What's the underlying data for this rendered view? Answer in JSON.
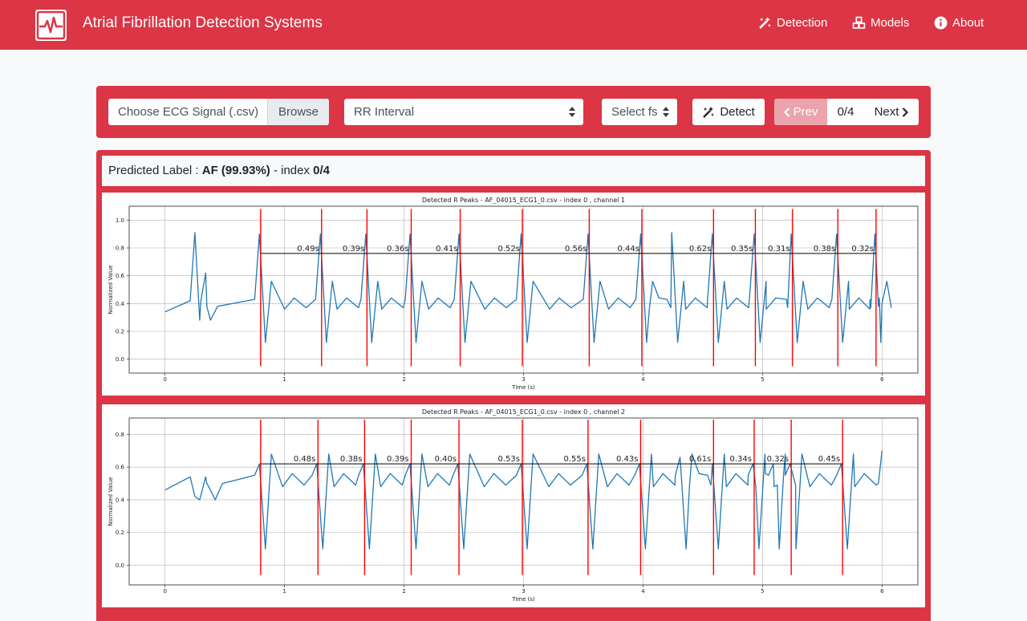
{
  "navbar": {
    "title": "Atrial Fibrillation Detection Systems",
    "logo_icon": "heartbeat-logo-icon",
    "items": [
      {
        "label": "Detection",
        "icon": "magic-wand-icon"
      },
      {
        "label": "Models",
        "icon": "cubes-icon"
      },
      {
        "label": "About",
        "icon": "info-circle-icon"
      }
    ]
  },
  "toolbar": {
    "file_placeholder": "Choose ECG Signal (.csv)",
    "browse_label": "Browse",
    "method_select": "RR Interval",
    "fs_select": "Select fs",
    "detect_label": "Detect",
    "prev_label": "Prev",
    "page_count": "0/4",
    "next_label": "Next"
  },
  "prediction": {
    "prefix": "Predicted Label :",
    "label": "AF (99.93%)",
    "index_prefix": "- index",
    "index": "0/4"
  },
  "colors": {
    "brand": "#dc3545",
    "signal": "#1f77b4",
    "r_peak": "#ff0000",
    "rr_line": "#000000"
  },
  "chart_data": [
    {
      "type": "line",
      "title": "Detected R Peaks - AF_04015_ECG1_0.csv - index 0 , channel 1",
      "xlabel": "Time (s)",
      "ylabel": "Normalized Value",
      "xlim": [
        -0.3,
        6.3
      ],
      "ylim": [
        -0.1,
        1.1
      ],
      "xticks": [
        0,
        1,
        2,
        3,
        4,
        5,
        6
      ],
      "yticks": [
        0.0,
        0.2,
        0.4,
        0.6,
        0.8,
        1.0
      ],
      "grid": true,
      "baseline": 0.38,
      "peak_value": 0.9,
      "trough_value": 0.12,
      "pre_peaks": [
        {
          "x": 0.25,
          "y": 0.91
        },
        {
          "x": 0.34,
          "y": 0.62
        }
      ],
      "r_peaks": [
        0.8,
        1.31,
        1.69,
        2.06,
        2.47,
        2.99,
        3.55,
        3.99,
        4.59,
        4.94,
        5.25,
        5.63,
        5.95
      ],
      "r_peak_line_range": [
        -0.05,
        1.08
      ],
      "rr_line_y": 0.76,
      "rr_intervals": [
        "0.49s",
        "0.39s",
        "0.36s",
        "0.41s",
        "0.52s",
        "0.56s",
        "0.44s",
        "0.62s",
        "0.35s",
        "0.31s",
        "0.38s",
        "0.32s"
      ],
      "extra_beats": [
        {
          "x": 4.25,
          "y": 0.91
        }
      ],
      "end": {
        "x": 6.0,
        "y": 0.4
      }
    },
    {
      "type": "line",
      "title": "Detected R Peaks - AF_04015_ECG1_0.csv - index 0 , channel 2",
      "xlabel": "Time (s)",
      "ylabel": "Normalized Value",
      "xlim": [
        -0.3,
        6.3
      ],
      "ylim": [
        -0.12,
        0.9
      ],
      "xticks": [
        0,
        1,
        2,
        3,
        4,
        5,
        6
      ],
      "yticks": [
        0.0,
        0.2,
        0.4,
        0.6,
        0.8
      ],
      "grid": true,
      "baseline": 0.5,
      "peak_value": 0.62,
      "trough_value": 0.1,
      "pre_peaks": [
        {
          "x": 0.25,
          "y": 0.42
        },
        {
          "x": 0.38,
          "y": 0.46
        }
      ],
      "r_peaks": [
        0.8,
        1.28,
        1.67,
        2.06,
        2.46,
        2.99,
        3.54,
        3.98,
        4.59,
        4.93,
        5.24,
        5.67
      ],
      "r_peak_line_range": [
        -0.06,
        0.89
      ],
      "rr_line_y": 0.62,
      "rr_intervals": [
        "0.48s",
        "0.38s",
        "0.39s",
        "0.40s",
        "0.53s",
        "0.55s",
        "0.43s",
        "0.61s",
        "0.34s",
        "0.32s",
        "0.45s"
      ],
      "extra_beats": [
        {
          "x": 4.32,
          "y": 0.66
        },
        {
          "x": 5.1,
          "y": 0.62
        }
      ],
      "end": {
        "x": 6.0,
        "y": 0.7
      }
    }
  ]
}
